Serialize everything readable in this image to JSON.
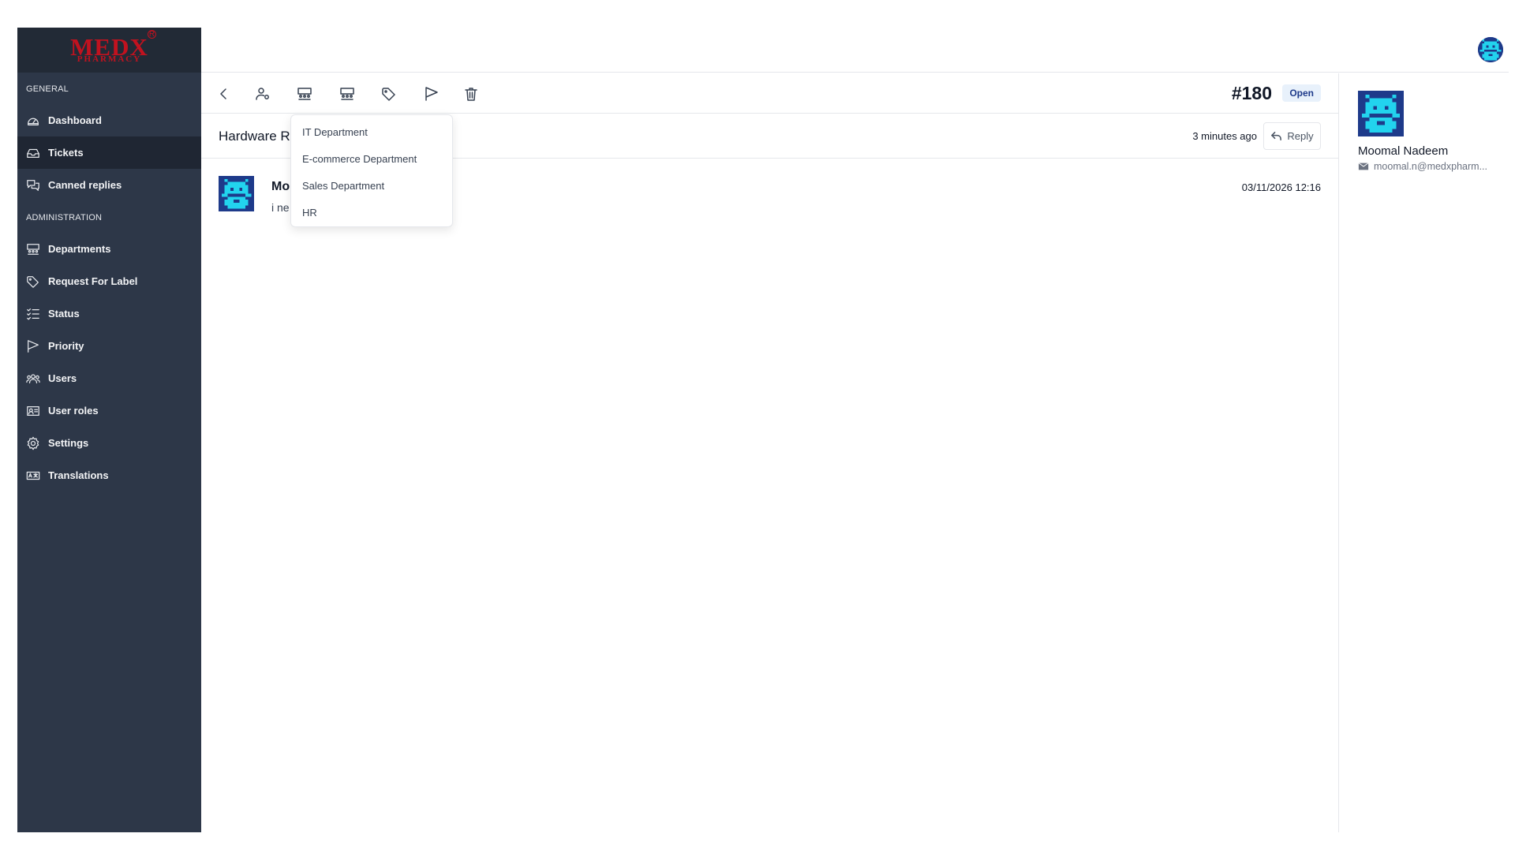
{
  "brand": {
    "logo_text": "MEDX",
    "logo_subtext": "PHARMACY",
    "logo_mark": "R"
  },
  "sidebar": {
    "sections": [
      {
        "label": "GENERAL",
        "items": [
          {
            "label": "Dashboard",
            "icon": "gauge-icon"
          },
          {
            "label": "Tickets",
            "icon": "inbox-icon",
            "active": true
          },
          {
            "label": "Canned replies",
            "icon": "chat-icon"
          }
        ]
      },
      {
        "label": "ADMINISTRATION",
        "items": [
          {
            "label": "Departments",
            "icon": "departments-icon"
          },
          {
            "label": "Request For Label",
            "icon": "tag-icon"
          },
          {
            "label": "Status",
            "icon": "list-check-icon"
          },
          {
            "label": "Priority",
            "icon": "flag-icon"
          },
          {
            "label": "Users",
            "icon": "users-icon"
          },
          {
            "label": "User roles",
            "icon": "id-card-icon"
          },
          {
            "label": "Settings",
            "icon": "gear-icon"
          },
          {
            "label": "Translations",
            "icon": "translate-icon"
          }
        ]
      }
    ]
  },
  "toolbar": {
    "icons": [
      "back-icon",
      "assign-user-icon",
      "department-icon",
      "department-alt-icon",
      "label-icon",
      "priority-flag-icon",
      "trash-icon"
    ]
  },
  "ticket": {
    "number": "#180",
    "status": "Open",
    "subject": "Hardware R",
    "time_ago": "3 minutes ago",
    "reply_label": "Reply"
  },
  "message": {
    "author": "Mo",
    "body": "i ne",
    "date": "03/11/2026 12:16"
  },
  "department_dropdown": {
    "options": [
      "IT Department",
      "E-commerce Department",
      "Sales Department",
      "HR"
    ]
  },
  "requester": {
    "name": "Moomal Nadeem",
    "email": "moomal.n@medxpharm..."
  },
  "colors": {
    "sidebar_bg": "#2d3748",
    "brand_red": "#c1121f",
    "badge_bg": "#e8f1fb",
    "badge_text": "#1e3a8a"
  }
}
